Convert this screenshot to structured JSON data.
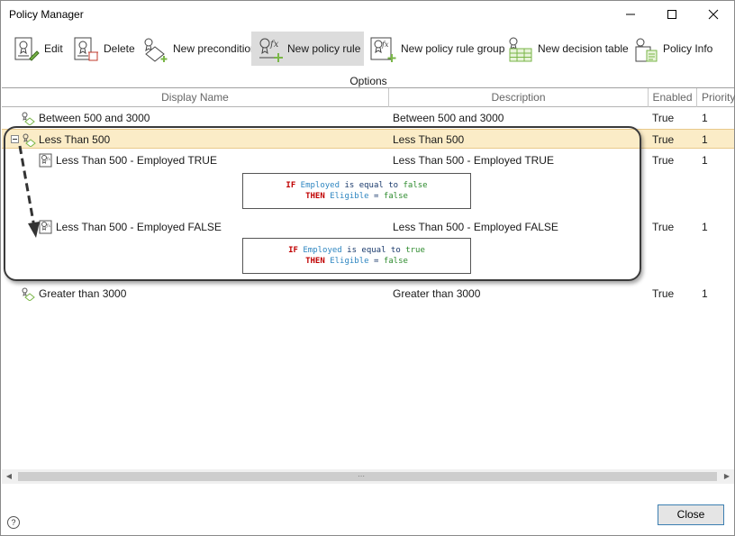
{
  "window": {
    "title": "Policy Manager",
    "controls": {
      "minimize": "minimize",
      "maximize": "maximize",
      "close": "close"
    }
  },
  "toolbar": {
    "group_label": "Options",
    "buttons": [
      {
        "label": "Edit",
        "icon": "edit-policy-icon",
        "active": false
      },
      {
        "label": "Delete",
        "icon": "delete-policy-icon",
        "active": false
      },
      {
        "label": "New precondition",
        "icon": "new-precondition-icon",
        "active": false
      },
      {
        "label": "New policy rule",
        "icon": "new-policy-rule-icon",
        "active": true
      },
      {
        "label": "New policy rule group",
        "icon": "new-policy-rule-group-icon",
        "active": false
      },
      {
        "label": "New decision table",
        "icon": "new-decision-table-icon",
        "active": false
      },
      {
        "label": "Policy Info",
        "icon": "policy-info-icon",
        "active": false
      }
    ]
  },
  "grid": {
    "columns": {
      "name": "Display Name",
      "description": "Description",
      "enabled": "Enabled",
      "priority": "Priority"
    },
    "rows": [
      {
        "name": "Between 500 and 3000",
        "description": "Between 500 and 3000",
        "enabled": "True",
        "priority": "1"
      },
      {
        "name": "Less Than 500",
        "description": "Less Than 500",
        "enabled": "True",
        "priority": "1"
      },
      {
        "name": "Less Than 500 - Employed TRUE",
        "description": "Less Than 500 - Employed TRUE",
        "enabled": "True",
        "priority": "1"
      },
      {
        "name": "Less Than 500 - Employed FALSE",
        "description": "Less Than 500 - Employed FALSE",
        "enabled": "True",
        "priority": "1"
      },
      {
        "name": "Greater than 3000",
        "description": "Greater than 3000",
        "enabled": "True",
        "priority": "1"
      }
    ],
    "conditions": [
      {
        "if": "IF",
        "var": "Employed",
        "op": "is equal to",
        "val": "false",
        "then": "THEN",
        "target": "Eligible",
        "eq": "=",
        "result": "false"
      },
      {
        "if": "IF",
        "var": "Employed",
        "op": "is equal to",
        "val": "true",
        "then": "THEN",
        "target": "Eligible",
        "eq": "=",
        "result": "false"
      }
    ]
  },
  "footer": {
    "help": "?",
    "close": "Close"
  },
  "colors": {
    "selection": "#fbecc7",
    "keyword": "#c00000",
    "variable": "#2e86c1",
    "value": "#2e8b2e"
  }
}
